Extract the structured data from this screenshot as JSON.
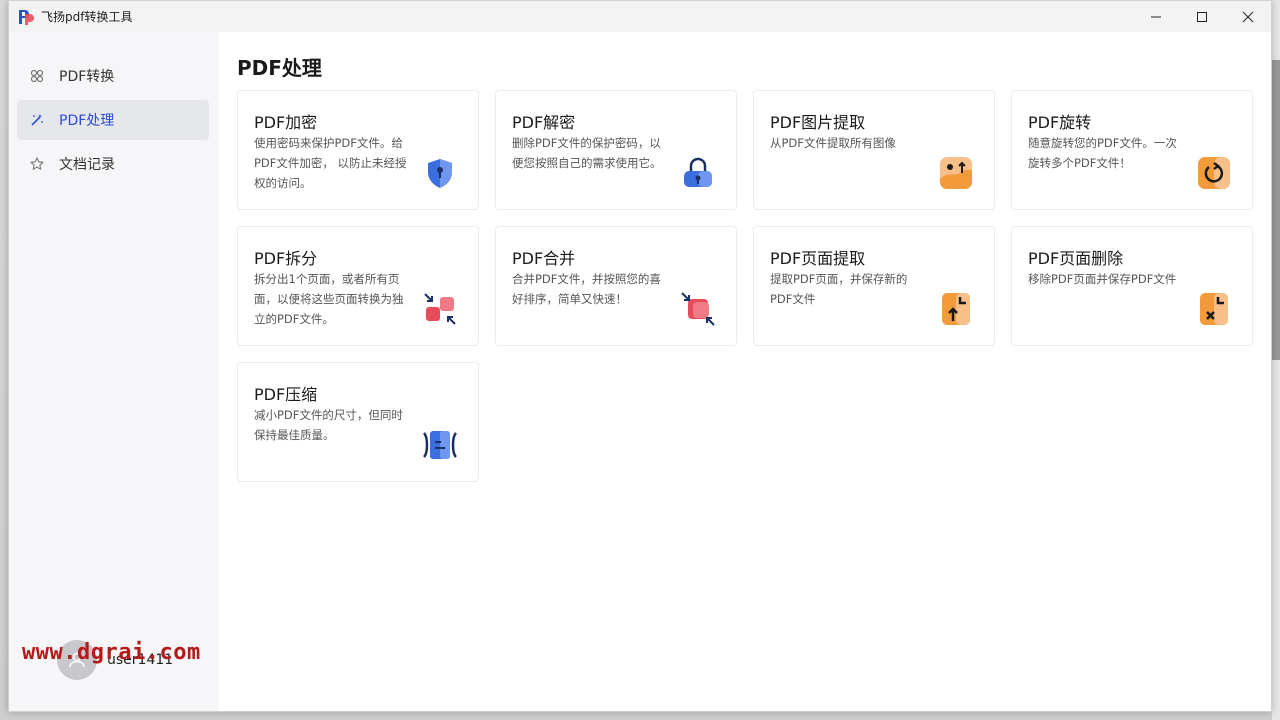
{
  "window": {
    "title": "飞扬pdf转换工具",
    "controls": [
      "minimize-icon",
      "maximize-icon",
      "close-icon"
    ]
  },
  "sidebar": {
    "items": [
      {
        "label": "PDF转换",
        "icon": "convert-icon",
        "active": false
      },
      {
        "label": "PDF处理",
        "icon": "magic-wand-icon",
        "active": true
      },
      {
        "label": "文档记录",
        "icon": "star-icon",
        "active": false
      }
    ],
    "user": {
      "name": "user1411"
    }
  },
  "watermark": "www.dgrai.com",
  "main": {
    "title": "PDF处理",
    "cards": [
      {
        "title": "PDF加密",
        "desc": "使用密码来保护PDF文件。给PDF文件加密， 以防止未经授权的访问。",
        "icon": "shield-lock-icon",
        "color": "#3b6fe0"
      },
      {
        "title": "PDF解密",
        "desc": "删除PDF文件的保护密码，以便您按照自己的需求使用它。",
        "icon": "unlock-icon",
        "color": "#3b6fe0"
      },
      {
        "title": "PDF图片提取",
        "desc": "从PDF文件提取所有图像",
        "icon": "image-extract-icon",
        "color": "#f39a3b"
      },
      {
        "title": "PDF旋转",
        "desc": "随意旋转您的PDF文件。一次旋转多个PDF文件！",
        "icon": "rotate-icon",
        "color": "#f39a3b"
      },
      {
        "title": "PDF拆分",
        "desc": "拆分出1个页面，或者所有页面，以便将这些页面转换为独立的PDF文件。",
        "icon": "split-icon",
        "color": "#e84c5a"
      },
      {
        "title": "PDF合并",
        "desc": "合并PDF文件，并按照您的喜好排序，简单又快速！",
        "icon": "merge-icon",
        "color": "#e84c5a"
      },
      {
        "title": "PDF页面提取",
        "desc": "提取PDF页面，并保存新的PDF文件",
        "icon": "page-extract-icon",
        "color": "#f39a3b"
      },
      {
        "title": "PDF页面删除",
        "desc": "移除PDF页面并保存PDF文件",
        "icon": "page-delete-icon",
        "color": "#f39a3b"
      },
      {
        "title": "PDF压缩",
        "desc": "减小PDF文件的尺寸，但同时保持最佳质量。",
        "icon": "compress-icon",
        "color": "#3b6fe0"
      }
    ]
  }
}
